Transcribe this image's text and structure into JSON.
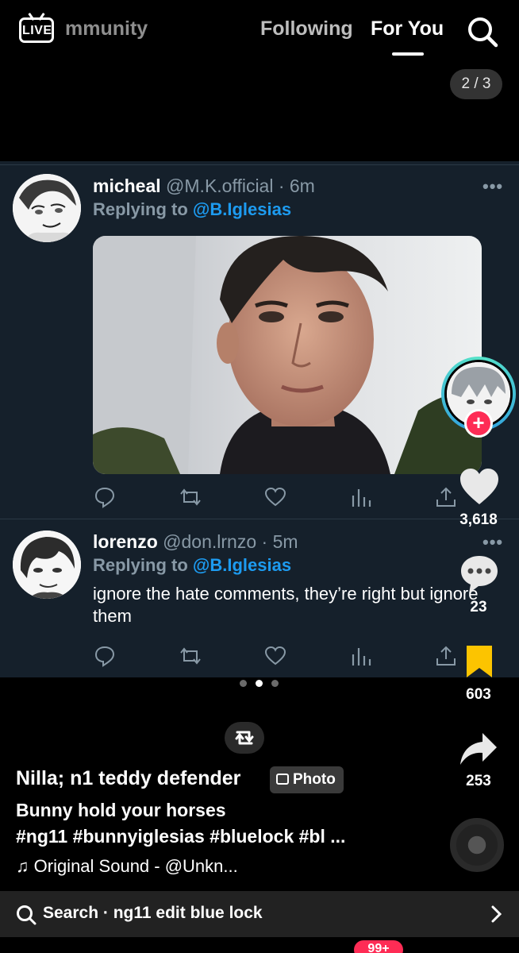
{
  "top_nav": {
    "live_label": "LIVE",
    "community_label": "mmunity",
    "following_label": "Following",
    "for_you_label": "For You"
  },
  "page_counter": "2 / 3",
  "tweets": [
    {
      "name": "micheal",
      "handle": "@M.K.official · 6m",
      "replying_prefix": "Replying to",
      "replying_to": "@B.Iglesias",
      "more": "•••",
      "has_photo": true
    },
    {
      "name": "lorenzo",
      "handle": "@don.lrnzo · 5m",
      "replying_prefix": "Replying to",
      "replying_to": "@B.Iglesias",
      "more": "•••",
      "text": "ignore the hate comments, they’re right but ignore them"
    }
  ],
  "rail": {
    "likes": "3,618",
    "comments": "23",
    "saves": "603",
    "shares": "253"
  },
  "carousel": {
    "count": 3,
    "active_index": 1
  },
  "post": {
    "author": "Nilla; n1 teddy defender",
    "badge": "Photo",
    "caption": "Bunny hold your horses",
    "hashtags": "#ng11 #bunnyiglesias #bluelock #bl ...",
    "sound": "Original Sound - @Unkn..."
  },
  "search_bar": {
    "label": "Search · ng11 edit blue lock"
  },
  "tabbar": {
    "inbox_badge": "99+"
  },
  "colors": {
    "background": "#000000",
    "card": "#15202b",
    "mention": "#1d9bf0",
    "muted": "#8899a6",
    "accent": "#fe2c55",
    "save": "#fcc400"
  }
}
